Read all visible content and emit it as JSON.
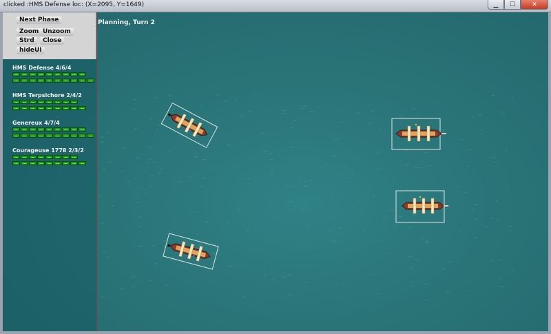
{
  "window": {
    "title": "clicked :HMS Defense loc: (X=2095, Y=1649)"
  },
  "menu": {
    "next_phase": "Next Phase",
    "zoom": "Zoom",
    "unzoom": "Unzoom",
    "strd": "Strd",
    "close": "Close",
    "hide_ui": "hideUI"
  },
  "status": {
    "text": "Planning, Turn 2"
  },
  "ships": [
    {
      "name": "HMS Defense  4/6/4",
      "bars": [
        9,
        10
      ]
    },
    {
      "name": "HMS Terpsichore  2/4/2",
      "bars": [
        8,
        9
      ]
    },
    {
      "name": "Genereux  4/7/4",
      "bars": [
        9,
        10
      ]
    },
    {
      "name": "Courageuse 1778  2/3/2",
      "bars": [
        8,
        9
      ]
    }
  ],
  "colors": {
    "sea": "#2a7478",
    "health_bar": "#1f9a1f",
    "selection_box": "#dfe6e6"
  }
}
